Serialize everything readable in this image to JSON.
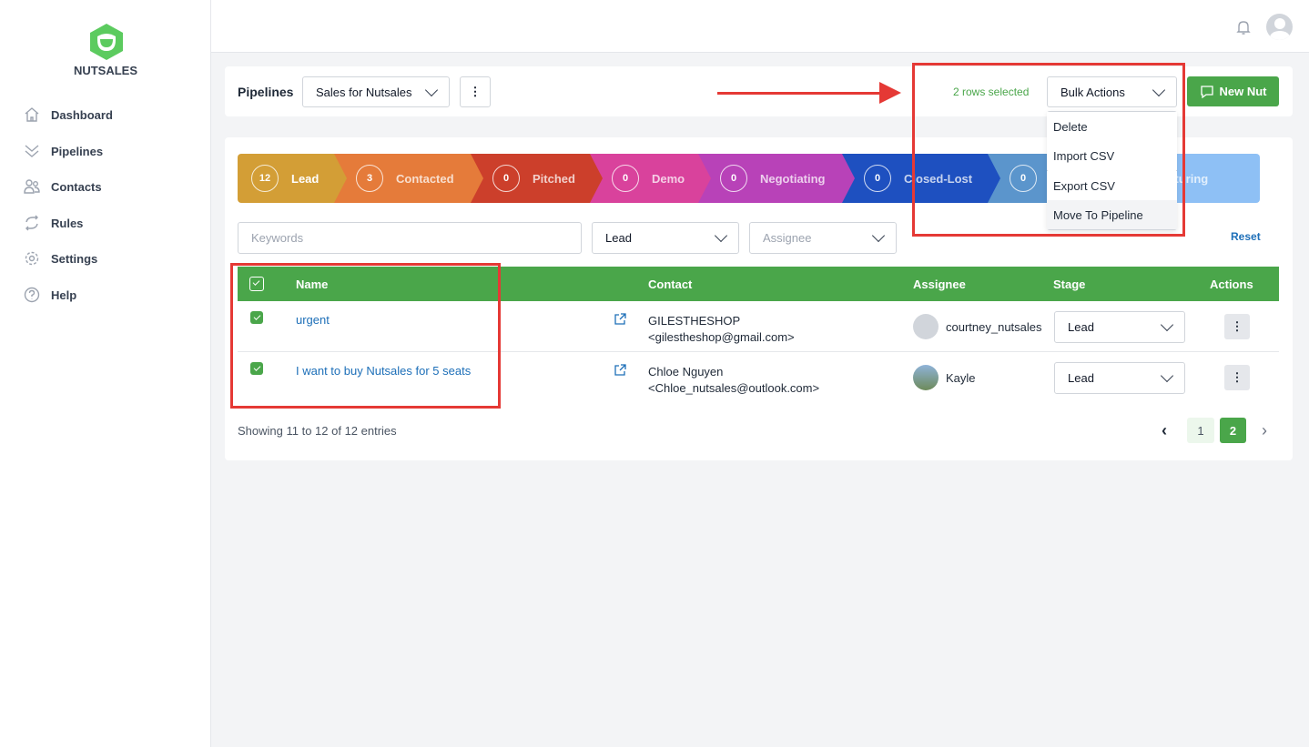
{
  "brand": {
    "name": "NUTSALES",
    "color": "#5ccb5f"
  },
  "sidebar": {
    "items": [
      {
        "label": "Dashboard",
        "icon": "home-icon"
      },
      {
        "label": "Pipelines",
        "icon": "double-chevron-down-icon"
      },
      {
        "label": "Contacts",
        "icon": "users-icon"
      },
      {
        "label": "Rules",
        "icon": "refresh-icon"
      },
      {
        "label": "Settings",
        "icon": "gear-icon"
      },
      {
        "label": "Help",
        "icon": "help-circle-icon"
      }
    ]
  },
  "toolbar": {
    "title": "Pipelines",
    "pipeline_select": "Sales for Nutsales",
    "more": "⋮",
    "selected_text": "2 rows selected",
    "bulk_actions": "Bulk Actions",
    "new_button": "New Nut",
    "accent": "#4aa64a"
  },
  "bulk_menu": {
    "items": [
      "Delete",
      "Import CSV",
      "Export CSV",
      "Move To Pipeline"
    ],
    "hovered": "Move To Pipeline"
  },
  "stages": [
    {
      "count": "12",
      "label": "Lead",
      "color": "#d39e36"
    },
    {
      "count": "3",
      "label": "Contacted",
      "color": "#e57b3a"
    },
    {
      "count": "0",
      "label": "Pitched",
      "color": "#cc3f2b"
    },
    {
      "count": "0",
      "label": "Demo",
      "color": "#d9429c"
    },
    {
      "count": "0",
      "label": "Negotiating",
      "color": "#b842b8"
    },
    {
      "count": "0",
      "label": "Closed-Lost",
      "color": "#1e50c0"
    },
    {
      "count": "0",
      "label": "",
      "color": "#5b95cc"
    },
    {
      "count": "",
      "label": "Nurturing",
      "color": "#8ec0f5"
    }
  ],
  "filters": {
    "keywords_placeholder": "Keywords",
    "stage": "Lead",
    "assignee_placeholder": "Assignee",
    "reset": "Reset"
  },
  "table": {
    "headers": {
      "name": "Name",
      "contact": "Contact",
      "assignee": "Assignee",
      "stage": "Stage",
      "actions": "Actions"
    },
    "rows": [
      {
        "name": "urgent",
        "contact_name": "GILESTHESHOP",
        "contact_email": "<gilestheshop@gmail.com>",
        "assignee": "courtney_nutsales",
        "stage": "Lead",
        "checked": true
      },
      {
        "name": "I want to buy Nutsales for 5 seats",
        "contact_name": "Chloe Nguyen",
        "contact_email": "<Chloe_nutsales@outlook.com>",
        "assignee": "Kayle",
        "stage": "Lead",
        "checked": true
      }
    ]
  },
  "pagination": {
    "summary": "Showing 11 to 12 of 12 entries",
    "pages": [
      "1",
      "2"
    ],
    "current": "2",
    "prev": "‹",
    "next": "›"
  },
  "annotation_color": "#e53935"
}
